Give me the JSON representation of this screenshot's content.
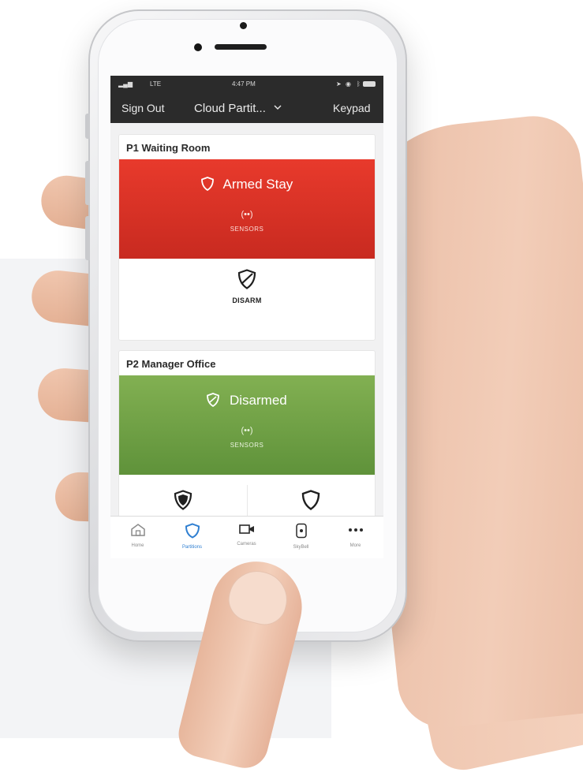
{
  "status_bar": {
    "signal": "LTE",
    "time": "4:47 PM"
  },
  "nav": {
    "sign_out": "Sign Out",
    "partition_selector": "Cloud Partit...",
    "keypad": "Keypad"
  },
  "partitions": [
    {
      "title": "P1 Waiting Room",
      "status": "Armed Stay",
      "status_color": "#d9322a",
      "sensors_label": "SENSORS",
      "action_label": "DISARM"
    },
    {
      "title": "P2 Manager Office",
      "status": "Disarmed",
      "status_color": "#6fa046",
      "sensors_label": "SENSORS"
    }
  ],
  "sensor_glyph": "(••)",
  "tabs": [
    {
      "label": "Home",
      "icon": "home-icon"
    },
    {
      "label": "Partitions",
      "icon": "shield-icon",
      "active": true
    },
    {
      "label": "Cameras",
      "icon": "camera-icon"
    },
    {
      "label": "SkyBell",
      "icon": "doorbell-icon"
    },
    {
      "label": "More",
      "icon": "more-icon"
    }
  ],
  "accent_color": "#2f7fd1"
}
